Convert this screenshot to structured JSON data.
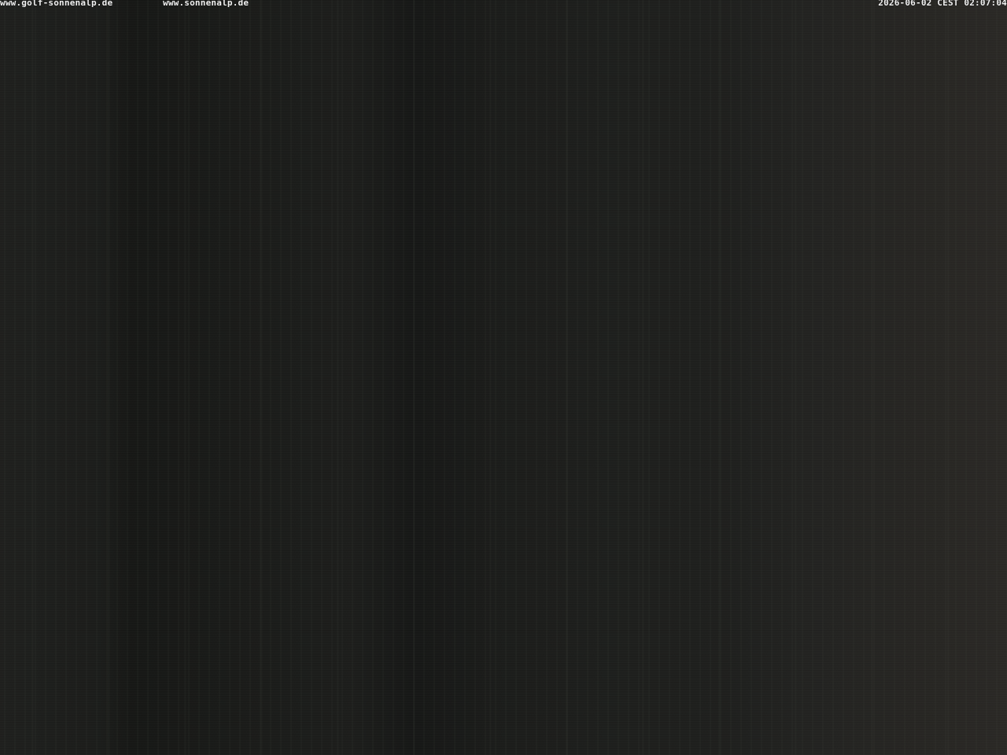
{
  "overlay": {
    "url_primary": "www.golf-sonnenalp.de",
    "url_secondary": "www.sonnenalp.de",
    "timestamp": "2026-06-02 CEST 02:07:04"
  },
  "colors": {
    "overlay_text": "#f2f2f2",
    "scene_dark": "#1a1b19",
    "scene_right": "#2a2825"
  }
}
